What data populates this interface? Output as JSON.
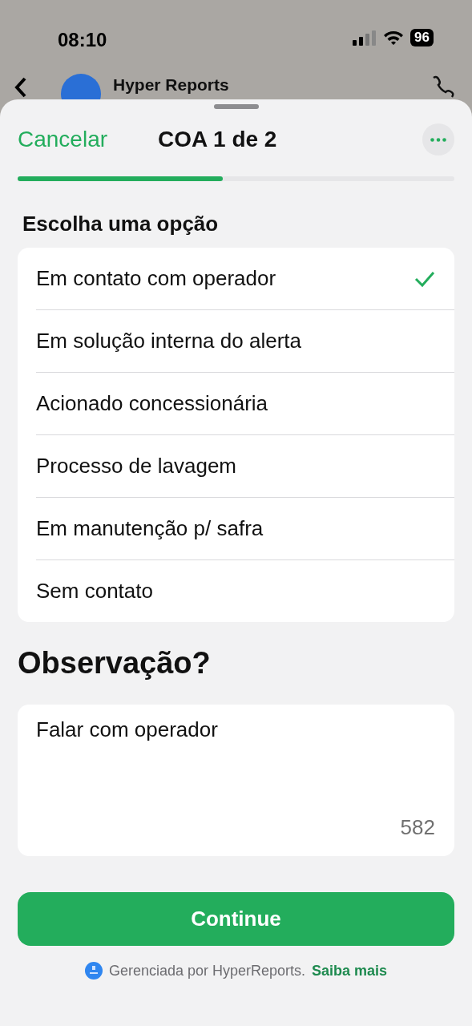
{
  "status_bar": {
    "time": "08:10",
    "battery": "96"
  },
  "chat_header": {
    "title": "Hyper Reports"
  },
  "sheet": {
    "cancel": "Cancelar",
    "title": "COA 1 de 2",
    "progress": {
      "level": 0.47
    }
  },
  "question": "Escolha uma opção",
  "options": [
    {
      "label": "Em contato com operador",
      "selected": true
    },
    {
      "label": "Em solução interna do alerta",
      "selected": false
    },
    {
      "label": "Acionado concessionária",
      "selected": false
    },
    {
      "label": "Processo de lavagem",
      "selected": false
    },
    {
      "label": "Em manutenção p/ safra",
      "selected": false
    },
    {
      "label": "Sem contato",
      "selected": false
    }
  ],
  "observation": {
    "heading": "Observação?",
    "value": "Falar com operador",
    "counter": "582"
  },
  "continue_button": "Continue",
  "footer": {
    "text": "Gerenciada por HyperReports.",
    "link": "Saiba mais"
  }
}
